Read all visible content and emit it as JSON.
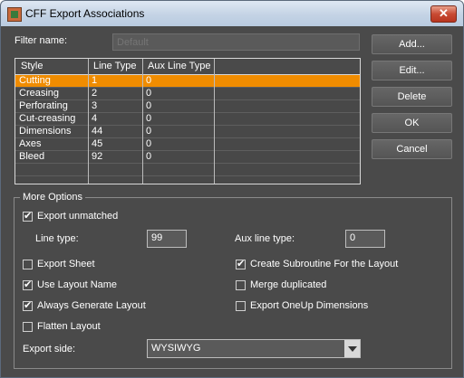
{
  "window": {
    "title": "CFF Export Associations",
    "close_glyph": "✕"
  },
  "filter": {
    "label": "Filter name:",
    "placeholder": "Default"
  },
  "table": {
    "columns": [
      "Style",
      "Line Type",
      "Aux Line Type"
    ],
    "rows": [
      [
        "Cutting",
        "1",
        "0"
      ],
      [
        "Creasing",
        "2",
        "0"
      ],
      [
        "Perforating",
        "3",
        "0"
      ],
      [
        "Cut-creasing",
        "4",
        "0"
      ],
      [
        "Dimensions",
        "44",
        "0"
      ],
      [
        "Axes",
        "45",
        "0"
      ],
      [
        "Bleed",
        "92",
        "0"
      ]
    ],
    "selected_row": 0
  },
  "buttons": {
    "add": "Add...",
    "edit": "Edit...",
    "delete": "Delete",
    "ok": "OK",
    "cancel": "Cancel"
  },
  "options": {
    "group_title": "More Options",
    "export_unmatched": {
      "label": "Export unmatched",
      "checked": true
    },
    "line_type": {
      "label": "Line type:",
      "value": "99"
    },
    "aux_line_type": {
      "label": "Aux line type:",
      "value": "0"
    },
    "export_sheet": {
      "label": "Export Sheet",
      "checked": false
    },
    "use_layout_name": {
      "label": "Use Layout Name",
      "checked": true
    },
    "always_generate_layout": {
      "label": "Always Generate Layout",
      "checked": true
    },
    "flatten_layout": {
      "label": "Flatten Layout",
      "checked": false
    },
    "create_subroutine": {
      "label": "Create Subroutine For the Layout",
      "checked": true
    },
    "merge_duplicated": {
      "label": "Merge duplicated",
      "checked": false
    },
    "export_oneup": {
      "label": "Export OneUp Dimensions",
      "checked": false
    },
    "export_side": {
      "label": "Export side:",
      "value": "WYSIWYG"
    }
  },
  "colors": {
    "selection": "#f08c00",
    "background": "#4a4a4a"
  }
}
